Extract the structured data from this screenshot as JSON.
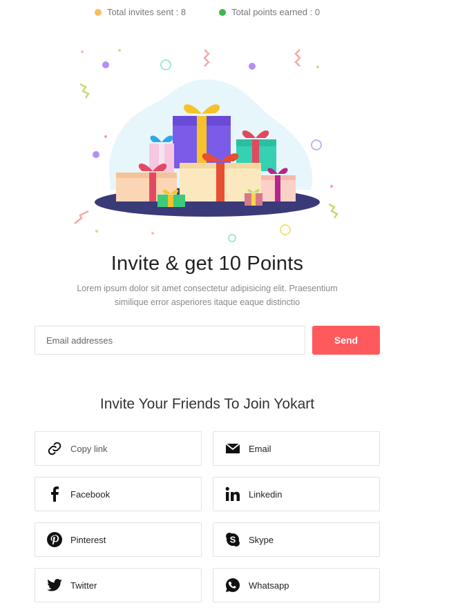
{
  "stats": {
    "invites_label": "Total invites sent : 8",
    "invites_color": "#f9be5b",
    "points_label": "Total points earned : 0",
    "points_color": "#3fb54c"
  },
  "hero": {
    "title": "Invite & get 10 Points",
    "description": "Lorem ipsum dolor sit amet consectetur adipisicing elit. Praesentium similique error asperiores itaque eaque distinctio"
  },
  "form": {
    "email_placeholder": "Email addresses",
    "email_value": "",
    "send_label": "Send"
  },
  "share": {
    "heading": "Invite Your Friends To Join Yokart",
    "buttons": [
      {
        "label": "Copy link",
        "icon": "link-icon"
      },
      {
        "label": "Email",
        "icon": "envelope-icon"
      },
      {
        "label": "Facebook",
        "icon": "facebook-icon"
      },
      {
        "label": "Linkedin",
        "icon": "linkedin-icon"
      },
      {
        "label": "Pinterest",
        "icon": "pinterest-icon"
      },
      {
        "label": "Skype",
        "icon": "skype-icon"
      },
      {
        "label": "Twitter",
        "icon": "twitter-icon"
      },
      {
        "label": "Whatsapp",
        "icon": "whatsapp-icon"
      }
    ]
  },
  "colors": {
    "accent": "#fe5a5e",
    "border": "#e2e2e2",
    "platform": "#3b3a79",
    "blob": "#e7f6fb"
  }
}
